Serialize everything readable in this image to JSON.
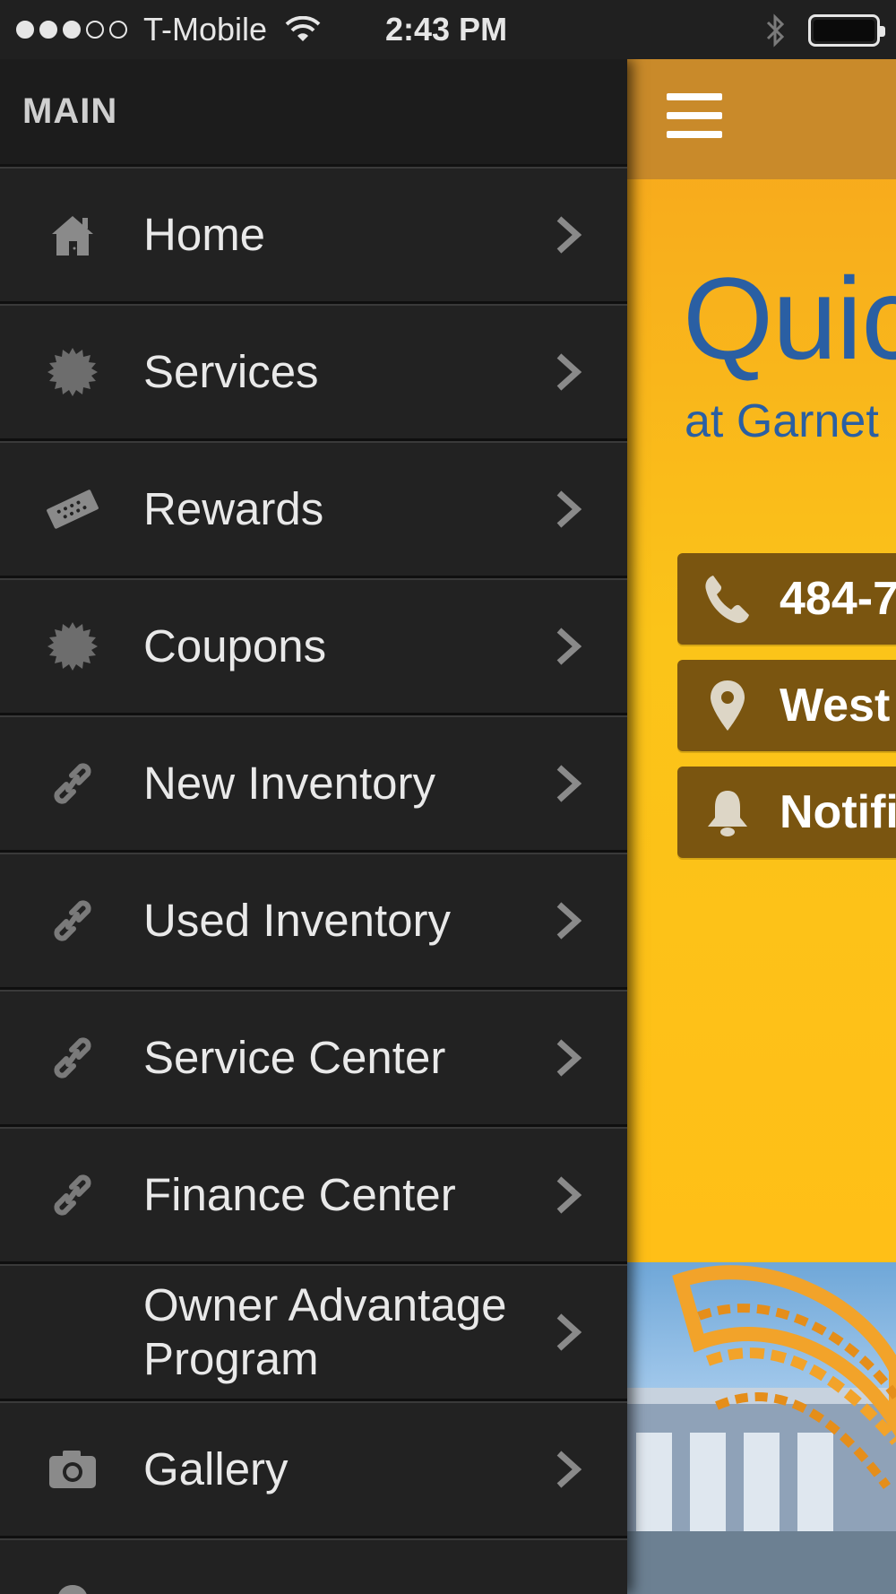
{
  "status_bar": {
    "carrier": "T-Mobile",
    "time": "2:43 PM",
    "signal_icon": "signal-dots-icon",
    "wifi_icon": "wifi-icon",
    "bluetooth_icon": "bluetooth-icon",
    "battery_icon": "battery-icon",
    "signal_bars_filled": 3,
    "signal_bars_total": 5
  },
  "drawer": {
    "header": "MAIN",
    "items": [
      {
        "label": "Home",
        "icon": "home-icon"
      },
      {
        "label": "Services",
        "icon": "badge-icon"
      },
      {
        "label": "Rewards",
        "icon": "ticket-icon"
      },
      {
        "label": "Coupons",
        "icon": "badge-icon"
      },
      {
        "label": "New Inventory",
        "icon": "link-icon"
      },
      {
        "label": "Used Inventory",
        "icon": "link-icon"
      },
      {
        "label": "Service Center",
        "icon": "link-icon"
      },
      {
        "label": "Finance Center",
        "icon": "link-icon"
      },
      {
        "label": "Owner Advantage Program",
        "icon": ""
      },
      {
        "label": "Gallery",
        "icon": "camera-icon"
      }
    ]
  },
  "app": {
    "menu_icon": "hamburger-icon",
    "title": "Quic",
    "subtitle": "at Garnet",
    "buttons": [
      {
        "label": "484-7",
        "icon": "phone-icon"
      },
      {
        "label": "West",
        "icon": "map-pin-icon"
      },
      {
        "label": "Notifi",
        "icon": "bell-icon"
      }
    ]
  },
  "colors": {
    "drawer_bg": "#222222",
    "accent_orange": "#fbc419",
    "header_orange": "#c98a2a",
    "title_blue": "#2a5fa3",
    "button_brown": "#7a5510"
  }
}
